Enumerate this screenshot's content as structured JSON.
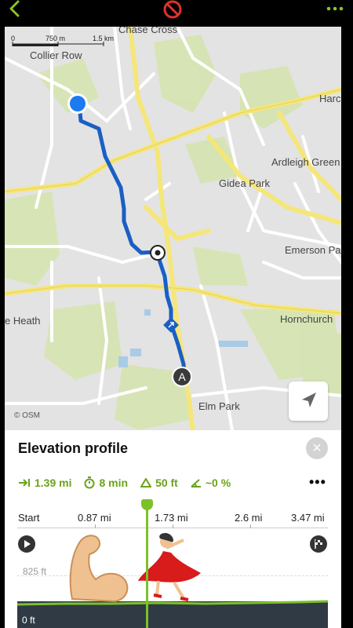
{
  "topbar": {
    "back_icon": "chevron-left-icon",
    "status_icon": "no-entry-icon",
    "more_icon": "more-dots-icon"
  },
  "map": {
    "scale": {
      "zero": "0",
      "mid": "750 m",
      "end": "1.5 km"
    },
    "labels": {
      "chase_cross": "Chase Cross",
      "collier_row": "Collier Row",
      "harold": "Harc",
      "ardleigh": "Ardleigh Green",
      "gidea": "Gidea Park",
      "emerson": "Emerson Pa",
      "heath": "e Heath",
      "hornchurch": "Hornchurch",
      "elm_park": "Elm Park"
    },
    "marker_a": "A",
    "attribution": "© OSM",
    "route_color": "#1a5fc4"
  },
  "panel": {
    "title": "Elevation profile",
    "close": "×",
    "stats": {
      "distance": "1.39 mi",
      "time": "8 min",
      "ascent": "50 ft",
      "slope": "~0 %"
    },
    "more": "•••",
    "axis": {
      "start": "Start",
      "t1": "0.87 mi",
      "t2": "1.73 mi",
      "t3": "2.6 mi",
      "t4": "3.47 mi"
    },
    "elev_top": "825 ft",
    "elev_bottom": "0 ft",
    "accent": "#7cc12a"
  }
}
